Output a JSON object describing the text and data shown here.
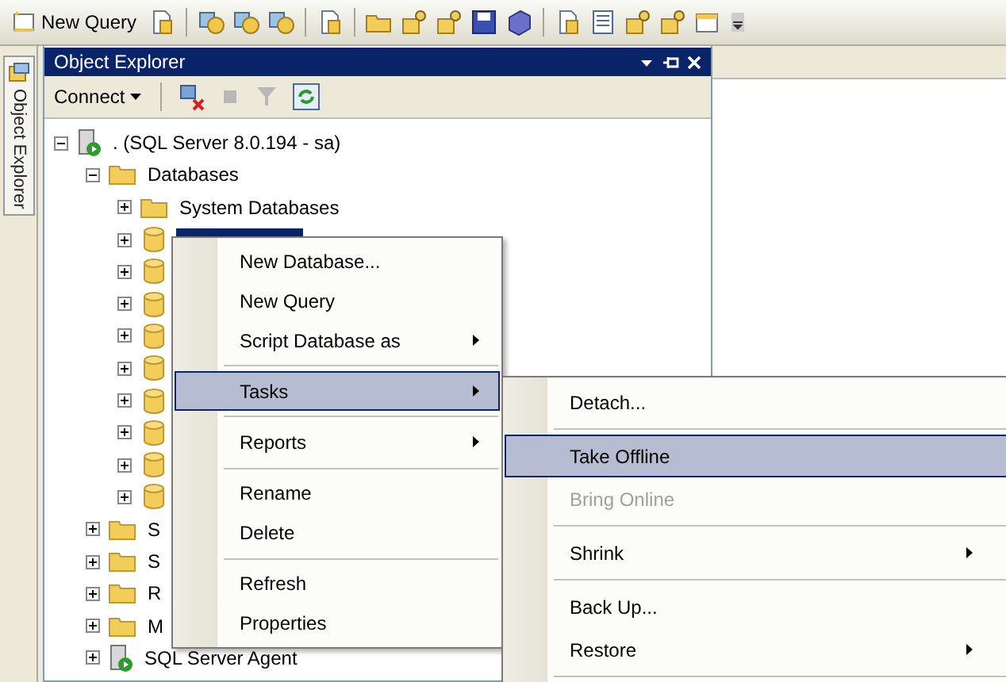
{
  "toolbar": {
    "new_query": "New Query"
  },
  "side_tab": {
    "label": "Object Explorer"
  },
  "object_explorer": {
    "title": "Object Explorer",
    "connect": "Connect",
    "tree": [
      {
        "label": ". (SQL Server 8.0.194 - sa)",
        "kind": "server",
        "expanded": true,
        "children": [
          {
            "label": "Databases",
            "kind": "folder",
            "expanded": true,
            "children": [
              {
                "label": "System Databases",
                "kind": "folder",
                "expanded": false,
                "selected": false
              },
              {
                "kind": "database",
                "expanded": false,
                "selected": true
              },
              {
                "kind": "database",
                "expanded": false
              },
              {
                "kind": "database",
                "expanded": false
              },
              {
                "kind": "database",
                "expanded": false
              },
              {
                "kind": "database",
                "expanded": false
              },
              {
                "kind": "database",
                "expanded": false
              },
              {
                "kind": "database",
                "expanded": false
              },
              {
                "kind": "database",
                "expanded": false
              },
              {
                "kind": "database",
                "expanded": false
              }
            ]
          },
          {
            "label": "S",
            "kind": "folder",
            "expanded": false
          },
          {
            "label": "S",
            "kind": "folder",
            "expanded": false
          },
          {
            "label": "R",
            "kind": "folder",
            "expanded": false
          },
          {
            "label": "M",
            "kind": "folder",
            "expanded": false
          },
          {
            "label": "SQL Server Agent",
            "kind": "agent",
            "expanded": false
          }
        ]
      }
    ]
  },
  "context_menu": {
    "items": [
      {
        "kind": "item",
        "label": "New Database...",
        "submenu": false,
        "selected": false
      },
      {
        "kind": "item",
        "label": "New Query",
        "submenu": false,
        "selected": false
      },
      {
        "kind": "item",
        "label": "Script Database as",
        "submenu": true,
        "selected": false
      },
      {
        "kind": "separator"
      },
      {
        "kind": "item",
        "label": "Tasks",
        "submenu": true,
        "selected": true
      },
      {
        "kind": "separator"
      },
      {
        "kind": "item",
        "label": "Reports",
        "submenu": true,
        "selected": false
      },
      {
        "kind": "separator"
      },
      {
        "kind": "item",
        "label": "Rename",
        "submenu": false,
        "selected": false
      },
      {
        "kind": "item",
        "label": "Delete",
        "submenu": false,
        "selected": false
      },
      {
        "kind": "separator"
      },
      {
        "kind": "item",
        "label": "Refresh",
        "submenu": false,
        "selected": false
      },
      {
        "kind": "item",
        "label": "Properties",
        "submenu": false,
        "selected": false
      }
    ]
  },
  "tasks_submenu": {
    "items": [
      {
        "kind": "item",
        "label": "Detach...",
        "submenu": false,
        "selected": false,
        "disabled": false
      },
      {
        "kind": "separator"
      },
      {
        "kind": "item",
        "label": "Take Offline",
        "submenu": false,
        "selected": true,
        "disabled": false
      },
      {
        "kind": "item",
        "label": "Bring Online",
        "submenu": false,
        "selected": false,
        "disabled": true
      },
      {
        "kind": "separator"
      },
      {
        "kind": "item",
        "label": "Shrink",
        "submenu": true,
        "selected": false,
        "disabled": false
      },
      {
        "kind": "separator"
      },
      {
        "kind": "item",
        "label": "Back Up...",
        "submenu": false,
        "selected": false,
        "disabled": false
      },
      {
        "kind": "item",
        "label": "Restore",
        "submenu": true,
        "selected": false,
        "disabled": false
      },
      {
        "kind": "separator"
      }
    ]
  }
}
